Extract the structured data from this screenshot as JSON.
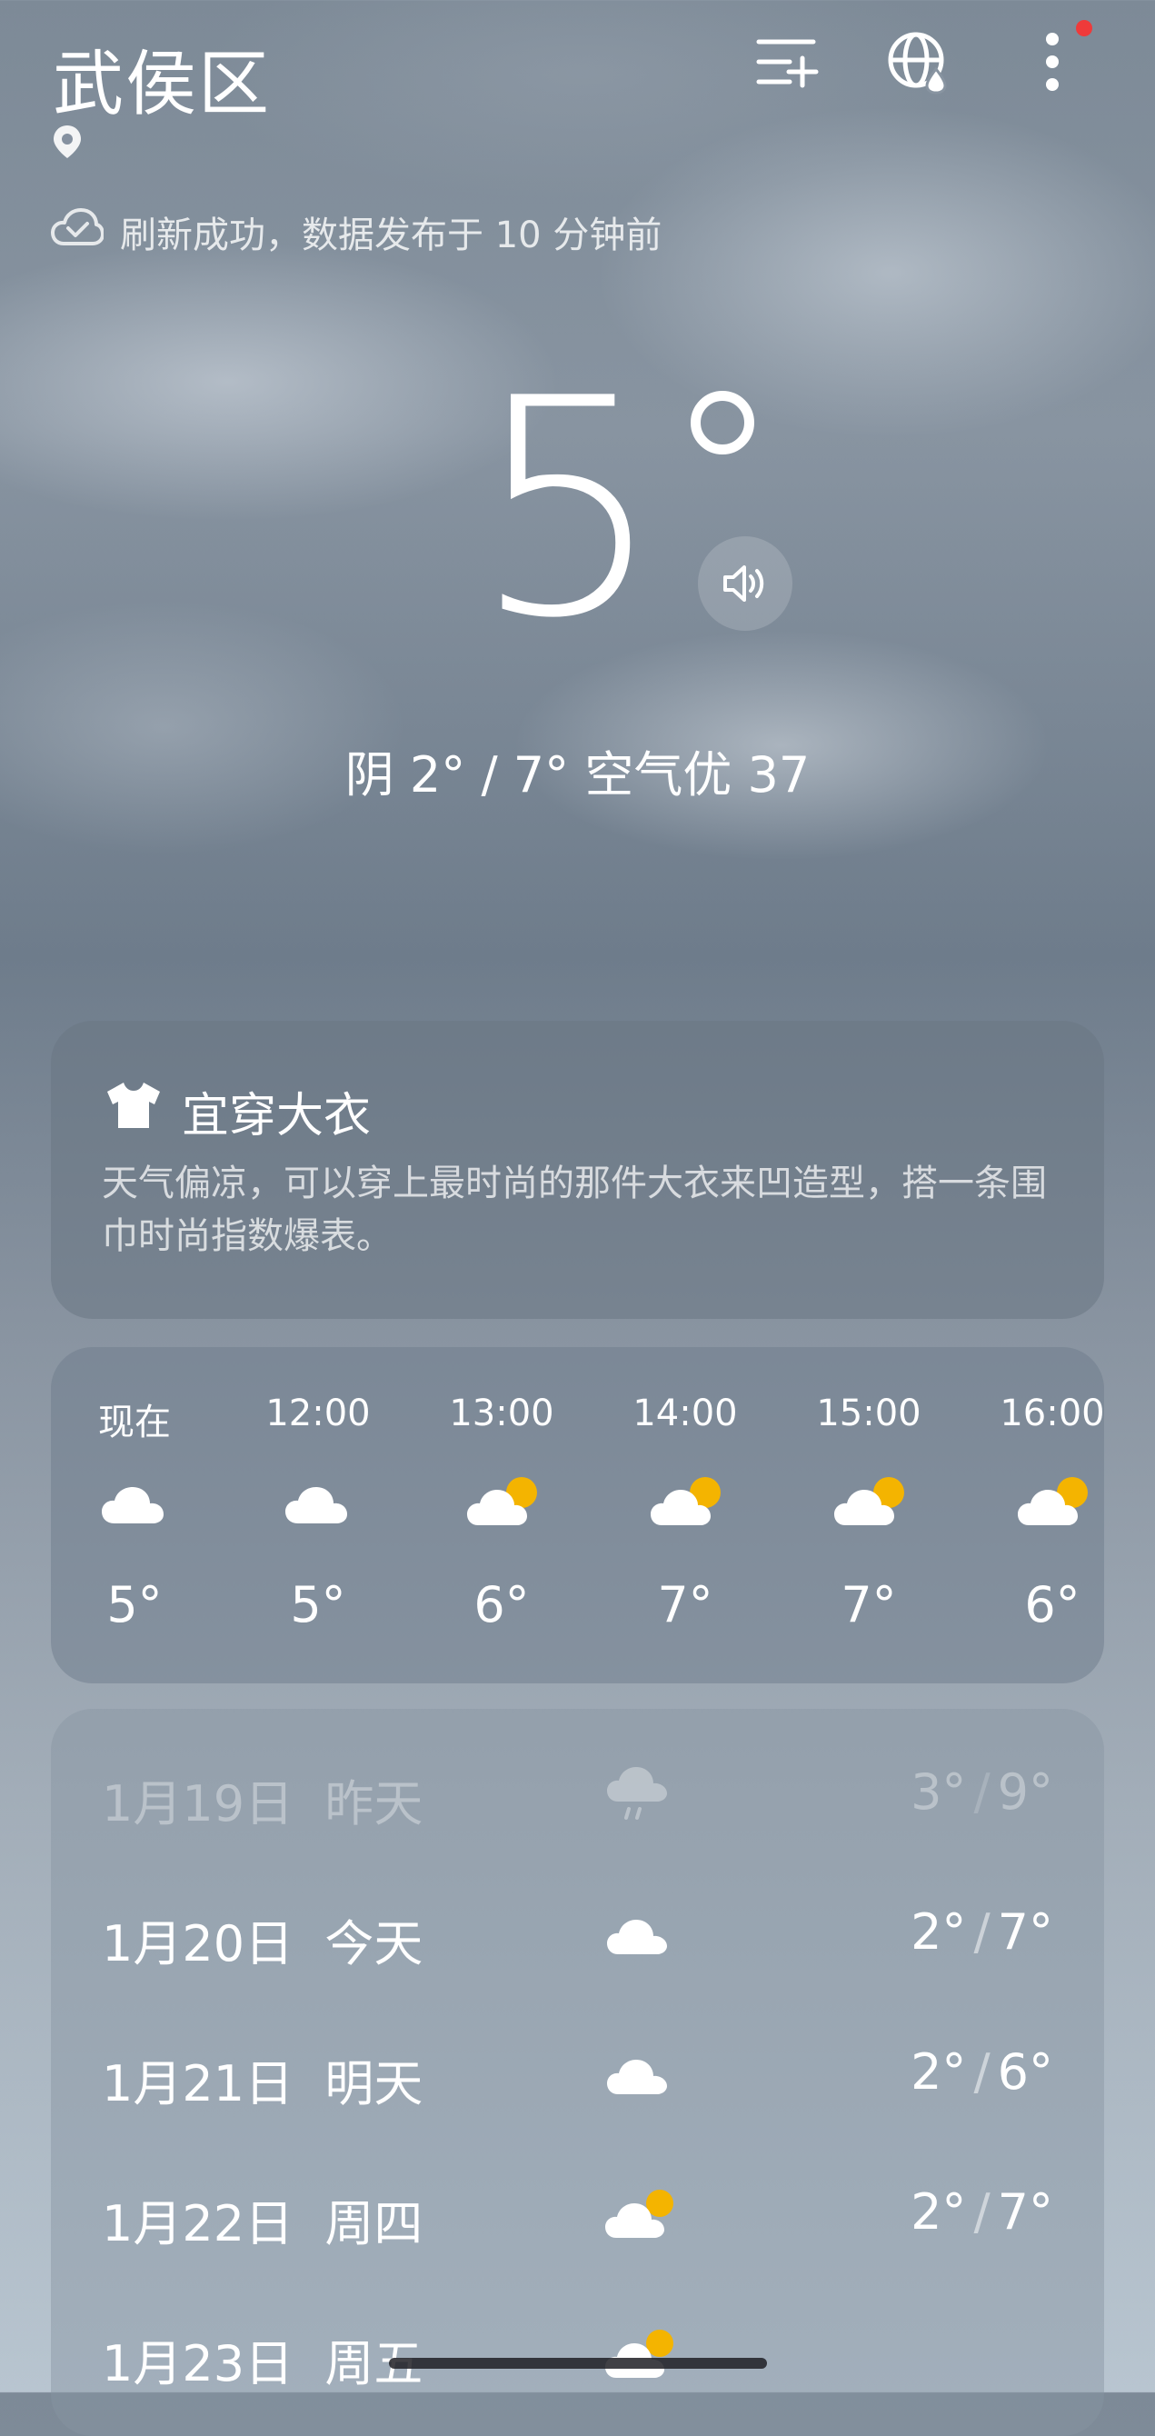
{
  "header": {
    "city": "武侯区",
    "refresh_text": "刷新成功，数据发布于 10 分钟前",
    "icons": [
      "location-pin-icon",
      "city-list-add-icon",
      "globe-weather-icon",
      "more-menu-icon"
    ]
  },
  "current": {
    "temperature": "5",
    "summary": "阴  2° / 7°  空气优 37"
  },
  "clothing": {
    "title": "宜穿大衣",
    "description": "天气偏凉，可以穿上最时尚的那件大衣来凹造型，搭一条围巾时尚指数爆表。"
  },
  "hourly": [
    {
      "time": "现在",
      "temp": "5°",
      "icon": "cloudy-icon"
    },
    {
      "time": "12:00",
      "temp": "5°",
      "icon": "cloudy-icon"
    },
    {
      "time": "13:00",
      "temp": "6°",
      "icon": "partly-cloudy-icon"
    },
    {
      "time": "14:00",
      "temp": "7°",
      "icon": "partly-cloudy-icon"
    },
    {
      "time": "15:00",
      "temp": "7°",
      "icon": "partly-cloudy-icon"
    },
    {
      "time": "16:00",
      "temp": "6°",
      "icon": "partly-cloudy-icon"
    }
  ],
  "daily": [
    {
      "date": "1月19日",
      "label": "昨天",
      "low": "3°",
      "high": "9°",
      "icon": "light-rain-icon",
      "faded": true
    },
    {
      "date": "1月20日",
      "label": "今天",
      "low": "2°",
      "high": "7°",
      "icon": "cloudy-icon"
    },
    {
      "date": "1月21日",
      "label": "明天",
      "low": "2°",
      "high": "6°",
      "icon": "cloudy-icon"
    },
    {
      "date": "1月22日",
      "label": "周四",
      "low": "2°",
      "high": "7°",
      "icon": "partly-cloudy-icon"
    },
    {
      "date": "1月23日",
      "label": "周五",
      "low": "",
      "high": "",
      "icon": "partly-cloudy-icon"
    }
  ],
  "colors": {
    "sun": "#f4b400",
    "notification_dot": "#ef3a3a"
  }
}
